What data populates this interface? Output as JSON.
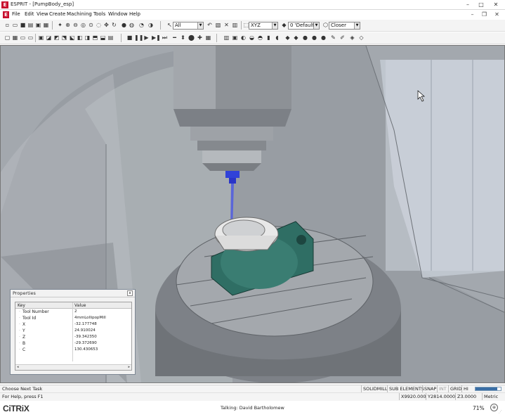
{
  "app": {
    "title": "ESPRIT - [PumpBody_esp]",
    "icon_letter": "E"
  },
  "window_controls": {
    "minimize": "–",
    "maximize": "□",
    "close": "✕"
  },
  "menu": {
    "items": [
      "File",
      "Edit",
      "View",
      "Create",
      "Machining",
      "Tools",
      "Window",
      "Help"
    ],
    "doc_controls": {
      "minimize": "–",
      "restore": "❐",
      "close": "✕"
    }
  },
  "toolbar1": {
    "filter_combo": "All",
    "plane_combo": "XYZ",
    "layer_combo": "0 'Default'",
    "view_combo": "Closer"
  },
  "properties": {
    "title": "Properties",
    "columns": [
      "Key",
      "Value"
    ],
    "rows": [
      {
        "key": "Tool Number",
        "value": "2"
      },
      {
        "key": "Tool Id",
        "value": "4mmLollipopMill"
      },
      {
        "key": "X",
        "value": "-32.177748"
      },
      {
        "key": "Y",
        "value": "24.910024"
      },
      {
        "key": "Z",
        "value": "-39.342350"
      },
      {
        "key": "B",
        "value": "-29.372690"
      },
      {
        "key": "C",
        "value": "130.430653"
      }
    ]
  },
  "status1": {
    "left_text": "Choose Next Task",
    "cells": [
      "SOLIDMILL",
      "SUB ELEMENTS",
      "SNAP",
      "INT",
      "GRID",
      "HI"
    ],
    "progress": 0.85
  },
  "status2": {
    "left_text": "For Help, press F1",
    "coords": [
      "X9920.000",
      "Y2814.0000",
      "Z3.0000"
    ],
    "units": "Metric"
  },
  "citrix": {
    "logo": "CiTRiX",
    "talking": "Talking: David Bartholomew",
    "zoom": "71%"
  },
  "colors": {
    "workpiece_teal": "#2f6e64",
    "tool_blue": "#2a35c8",
    "machine_gray": "#9a9fa6",
    "progress_blue": "#3a6ea5"
  }
}
